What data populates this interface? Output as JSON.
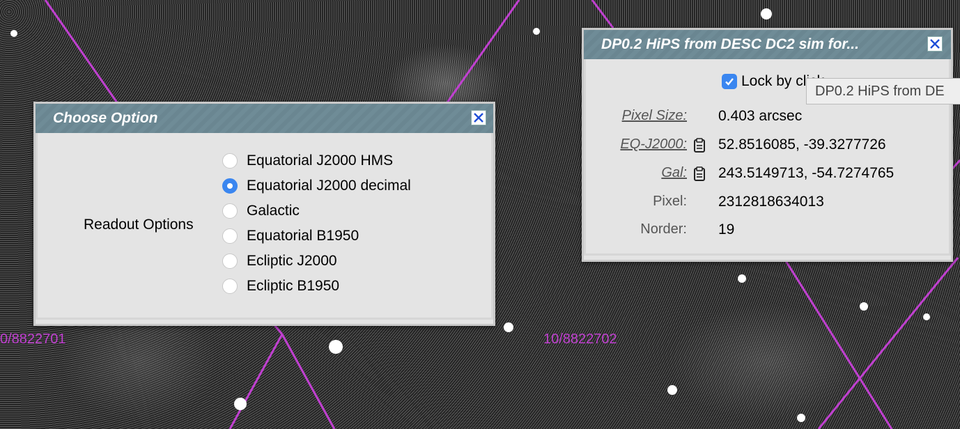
{
  "grid_labels": [
    "0/8822701",
    "10/8822702"
  ],
  "choose_dialog": {
    "title": "Choose Option",
    "readout_label": "Readout Options",
    "options": [
      {
        "label": "Equatorial J2000 HMS",
        "checked": false
      },
      {
        "label": "Equatorial J2000 decimal",
        "checked": true
      },
      {
        "label": "Galactic",
        "checked": false
      },
      {
        "label": "Equatorial B1950",
        "checked": false
      },
      {
        "label": "Ecliptic J2000",
        "checked": false
      },
      {
        "label": "Ecliptic B1950",
        "checked": false
      }
    ],
    "close_icon": "close-icon"
  },
  "info_dialog": {
    "title": "DP0.2 HiPS from DESC DC2 sim for...",
    "lock_label": "Lock by click",
    "lock_checked": true,
    "rows": [
      {
        "key": "Pixel Size:",
        "value": "0.403 arcsec",
        "link": true,
        "copy": false
      },
      {
        "key": "EQ-J2000:",
        "value": "52.8516085, -39.3277726",
        "link": true,
        "copy": true
      },
      {
        "key": "Gal:",
        "value": "243.5149713, -54.7274765",
        "link": true,
        "copy": true
      },
      {
        "key": "Pixel:",
        "value": "2312818634013",
        "link": false,
        "copy": false
      },
      {
        "key": "Norder:",
        "value": "19",
        "link": false,
        "copy": false
      }
    ]
  },
  "tooltip": {
    "text": "DP0.2 HiPS from DE"
  },
  "colors": {
    "accent": "#3a86f0",
    "titlebar": "#6f8c97",
    "grid_line": "#c040d0"
  }
}
